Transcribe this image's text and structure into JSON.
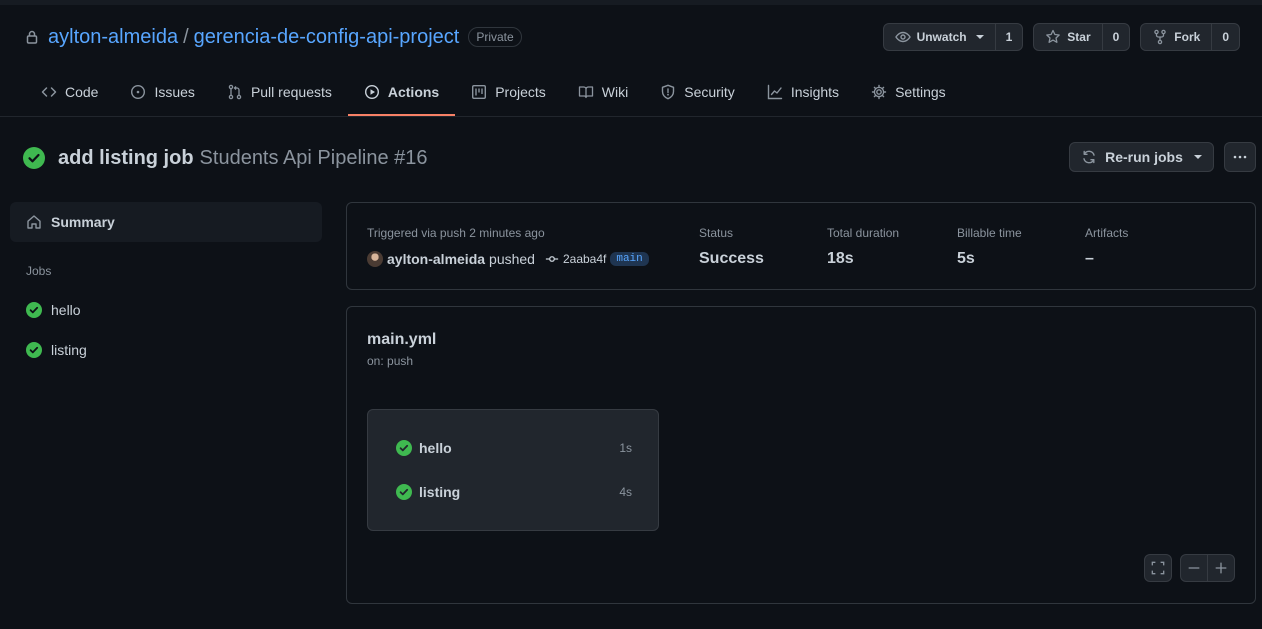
{
  "repo": {
    "owner": "aylton-almeida",
    "separator": "/",
    "name": "gerencia-de-config-api-project",
    "visibility": "Private",
    "icon": "lock-icon"
  },
  "repo_actions": {
    "watch": {
      "label": "Unwatch",
      "count": "1",
      "icon": "eye-icon"
    },
    "star": {
      "label": "Star",
      "count": "0",
      "icon": "star-icon"
    },
    "fork": {
      "label": "Fork",
      "count": "0",
      "icon": "fork-icon"
    }
  },
  "tabs": [
    {
      "label": "Code",
      "icon": "code-icon",
      "active": false
    },
    {
      "label": "Issues",
      "icon": "issue-icon",
      "active": false
    },
    {
      "label": "Pull requests",
      "icon": "pull-request-icon",
      "active": false
    },
    {
      "label": "Actions",
      "icon": "play-icon",
      "active": true
    },
    {
      "label": "Projects",
      "icon": "project-icon",
      "active": false
    },
    {
      "label": "Wiki",
      "icon": "book-icon",
      "active": false
    },
    {
      "label": "Security",
      "icon": "shield-icon",
      "active": false
    },
    {
      "label": "Insights",
      "icon": "graph-icon",
      "active": false
    },
    {
      "label": "Settings",
      "icon": "gear-icon",
      "active": false
    }
  ],
  "run": {
    "title": "add listing job",
    "workflow": "Students Api Pipeline #16",
    "status_icon": "check-circle-icon",
    "rerun_label": "Re-run jobs",
    "more_icon": "kebab-icon"
  },
  "sidebar": {
    "summary_label": "Summary",
    "jobs_heading": "Jobs",
    "jobs": [
      {
        "name": "hello",
        "status": "success"
      },
      {
        "name": "listing",
        "status": "success"
      }
    ]
  },
  "summary": {
    "trigger_text": "Triggered via push 2 minutes ago",
    "actor": "aylton-almeida",
    "action": "pushed",
    "commit": "2aaba4f",
    "branch": "main",
    "status_label": "Status",
    "status_value": "Success",
    "duration_label": "Total duration",
    "duration_value": "18s",
    "billable_label": "Billable time",
    "billable_value": "5s",
    "artifacts_label": "Artifacts",
    "artifacts_value": "–"
  },
  "workflow": {
    "file": "main.yml",
    "trigger": "on: push",
    "jobs": [
      {
        "name": "hello",
        "duration": "1s"
      },
      {
        "name": "listing",
        "duration": "4s"
      }
    ]
  },
  "colors": {
    "background": "#0d1117",
    "link": "#58a6ff",
    "success": "#3fb950",
    "tab_underline": "#f78166"
  }
}
